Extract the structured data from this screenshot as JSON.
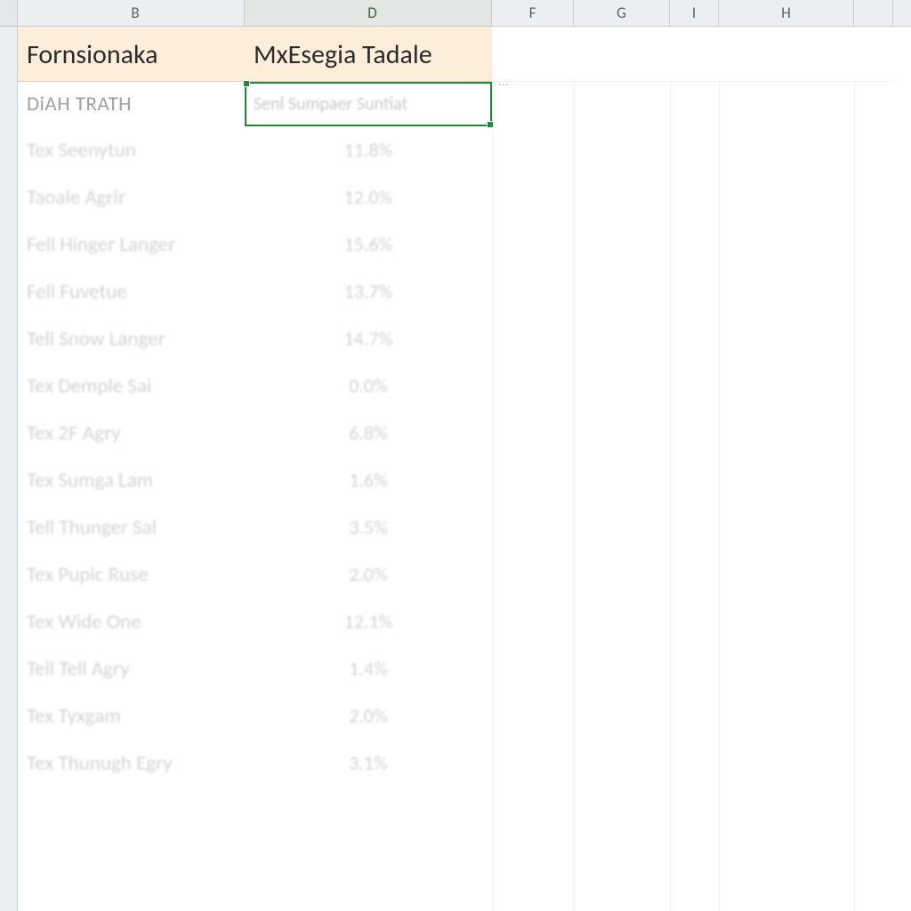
{
  "columns": [
    "B",
    "D",
    "F",
    "G",
    "I",
    "H"
  ],
  "header_row": {
    "B": "Fornsionaka",
    "D": "MxEsegia Tadale"
  },
  "sub_row": {
    "B": "DiAH TRATH",
    "D": "Senl Sumpaer Suntiat"
  },
  "data_rows": [
    {
      "label": "Tex Seenytun",
      "value": "11.8%"
    },
    {
      "label": "Taoale Agrir",
      "value": "12.0%"
    },
    {
      "label": "Fell Hinger Langer",
      "value": "15.6%"
    },
    {
      "label": "Fell Fuvetue",
      "value": "13.7%"
    },
    {
      "label": "Tell Snow Langer",
      "value": "14.7%"
    },
    {
      "label": "Tex Demple Sai",
      "value": "0.0%"
    },
    {
      "label": "Tex 2F Agry",
      "value": "6.8%"
    },
    {
      "label": "Tex Sumga Lam",
      "value": "1.6%"
    },
    {
      "label": "Tell Thunger Sal",
      "value": "3.5%"
    },
    {
      "label": "Tex Pupic Ruse",
      "value": "2.0%"
    },
    {
      "label": "Tex Wide One",
      "value": "12.1%"
    },
    {
      "label": "Tell Tell Agry",
      "value": "1.4%"
    },
    {
      "label": "Tex Tyxgam",
      "value": "2.0%"
    },
    {
      "label": "Tex Thunugh Egry",
      "value": "3.1%"
    }
  ],
  "selection": {
    "cell": "D2"
  },
  "paste_icon_hint": "⋯"
}
